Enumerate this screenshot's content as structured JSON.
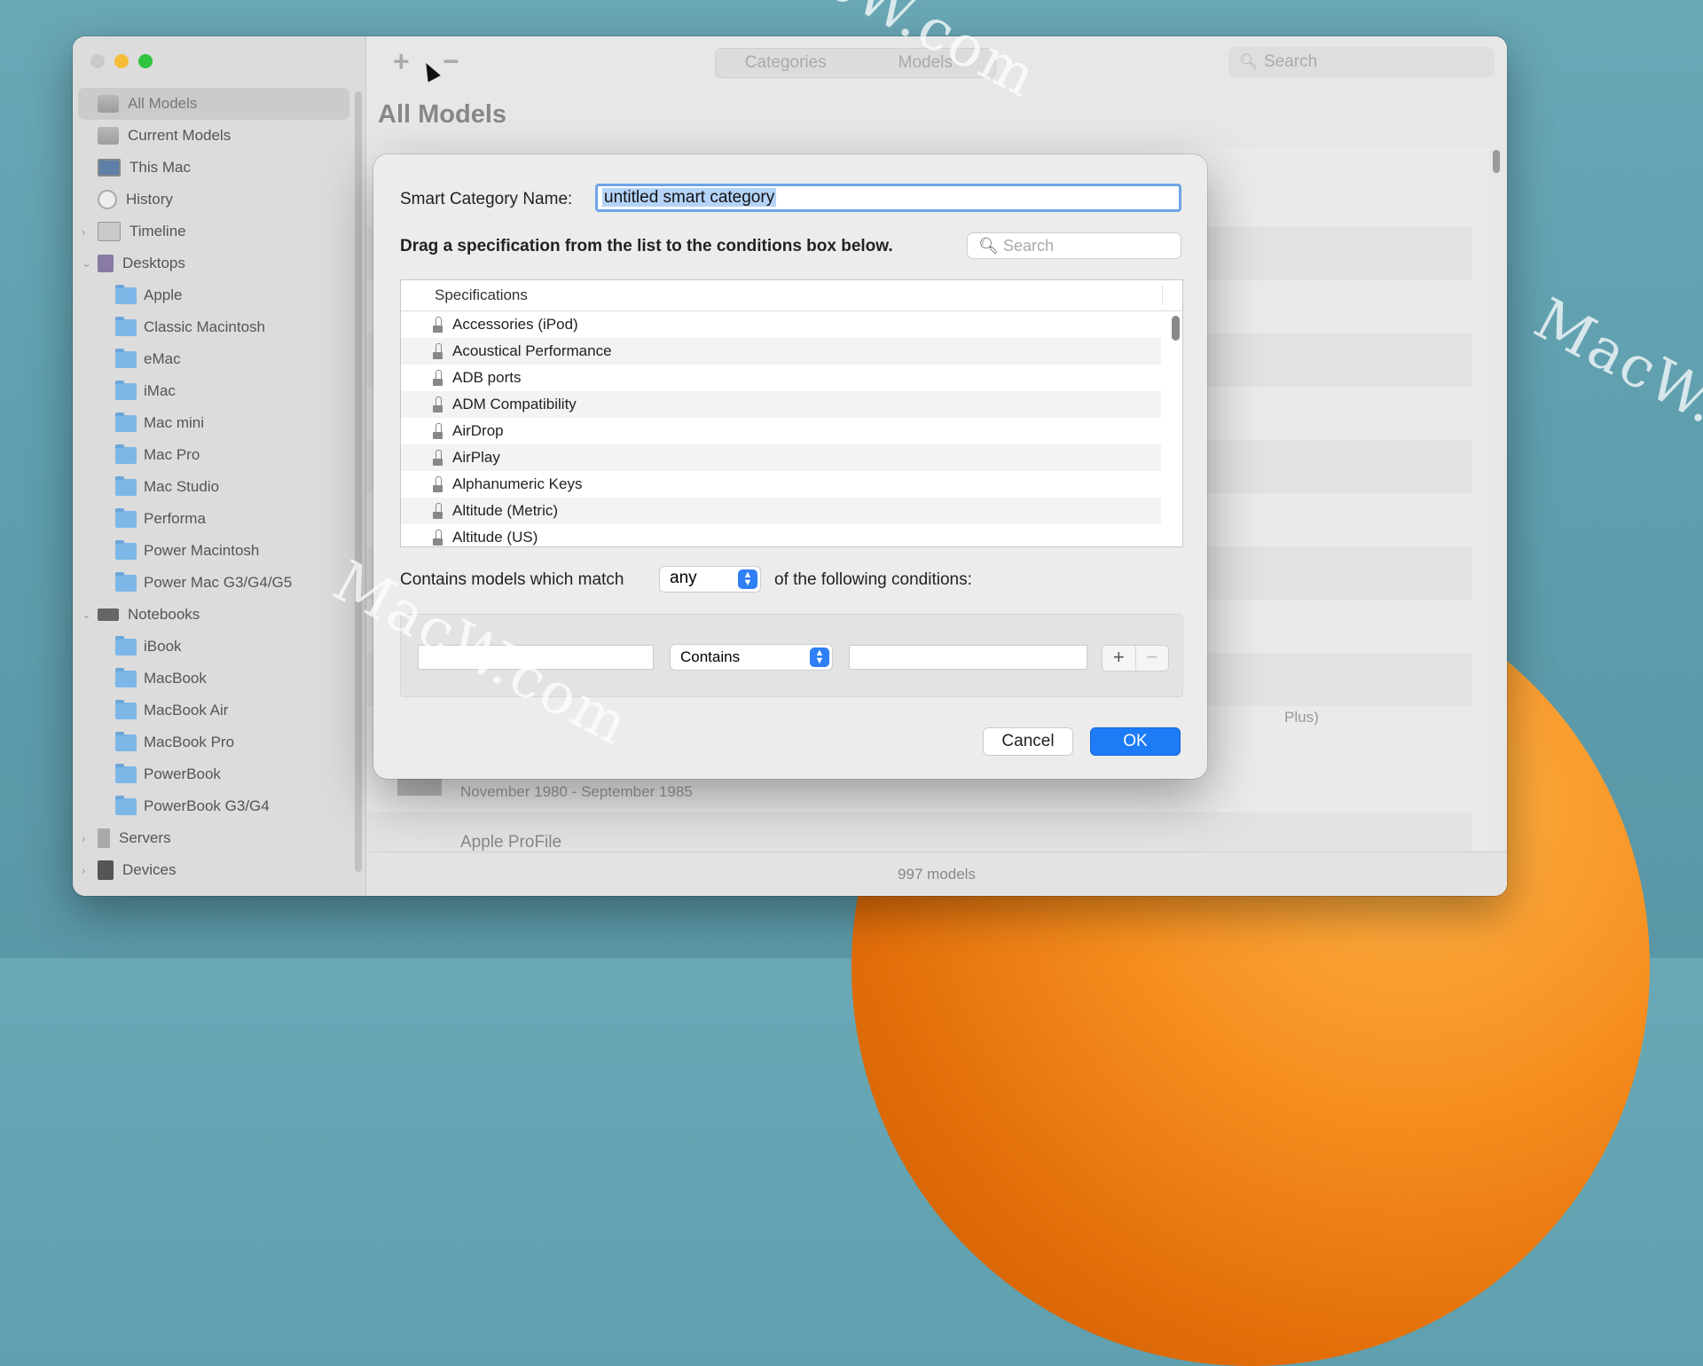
{
  "window": {
    "sidebar": {
      "items": [
        {
          "label": "All Models",
          "icon": "stack-icon",
          "selected": true
        },
        {
          "label": "Current Models",
          "icon": "stack-icon"
        },
        {
          "label": "This Mac",
          "icon": "display-icon"
        },
        {
          "label": "History",
          "icon": "clock-icon"
        },
        {
          "label": "Timeline",
          "icon": "timeline-icon",
          "collapsed": true
        },
        {
          "label": "Desktops",
          "icon": "desktop-icon",
          "expanded": true
        },
        {
          "label": "Apple",
          "icon": "folder-icon"
        },
        {
          "label": "Classic Macintosh",
          "icon": "folder-icon"
        },
        {
          "label": "eMac",
          "icon": "folder-icon"
        },
        {
          "label": "iMac",
          "icon": "folder-icon"
        },
        {
          "label": "Mac mini",
          "icon": "folder-icon"
        },
        {
          "label": "Mac Pro",
          "icon": "folder-icon"
        },
        {
          "label": "Mac Studio",
          "icon": "folder-icon"
        },
        {
          "label": "Performa",
          "icon": "folder-icon"
        },
        {
          "label": "Power Macintosh",
          "icon": "folder-icon"
        },
        {
          "label": "Power Mac G3/G4/G5",
          "icon": "folder-icon"
        },
        {
          "label": "Notebooks",
          "icon": "laptop-icon",
          "expanded": true
        },
        {
          "label": "iBook",
          "icon": "folder-icon"
        },
        {
          "label": "MacBook",
          "icon": "folder-icon"
        },
        {
          "label": "MacBook Air",
          "icon": "folder-icon"
        },
        {
          "label": "MacBook Pro",
          "icon": "folder-icon"
        },
        {
          "label": "PowerBook",
          "icon": "folder-icon"
        },
        {
          "label": "PowerBook G3/G4",
          "icon": "folder-icon"
        },
        {
          "label": "Servers",
          "icon": "server-icon",
          "collapsed": true
        },
        {
          "label": "Devices",
          "icon": "device-icon",
          "collapsed": true
        }
      ]
    },
    "toolbar": {
      "add_label": "+",
      "remove_label": "−",
      "segments": [
        "Categories",
        "Models"
      ],
      "search_placeholder": "Search"
    },
    "page_title": "All Models",
    "background_rows": {
      "partial_text": "Plus)",
      "date_range": "November 1980 - September 1985",
      "item_name": "Apple ProFile"
    },
    "status": "997 models"
  },
  "sheet": {
    "name_label": "Smart Category Name:",
    "name_value": "untitled smart category",
    "instruction": "Drag a specification from the list to the conditions box below.",
    "search_placeholder": "Search",
    "spec_header": "Specifications",
    "specs": [
      "Accessories (iPod)",
      "Acoustical Performance",
      "ADB ports",
      "ADM Compatibility",
      "AirDrop",
      "AirPlay",
      "Alphanumeric Keys",
      "Altitude (Metric)",
      "Altitude (US)"
    ],
    "match_prefix": "Contains models which match",
    "match_value": "any",
    "match_suffix": "of the following conditions:",
    "condition": {
      "field_value": "",
      "operator": "Contains",
      "value": ""
    },
    "add_condition": "+",
    "remove_condition": "−",
    "cancel_label": "Cancel",
    "ok_label": "OK"
  },
  "watermarks": [
    "MacW.com",
    "MacW.c",
    "MacW.com"
  ],
  "colors": {
    "accent": "#1d7bf5",
    "selection": "#b4d3f7"
  }
}
